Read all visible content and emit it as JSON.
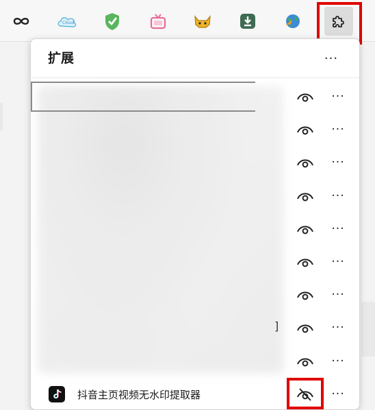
{
  "toolbar": {
    "buttons": [
      {
        "name": "reading-glasses-icon",
        "glyph": "∞"
      },
      {
        "name": "cloud-extension-icon",
        "glyph": "☁"
      },
      {
        "name": "adguard-shield-icon",
        "glyph": "✓"
      },
      {
        "name": "tv-extension-icon",
        "glyph": "📺"
      },
      {
        "name": "tampermonkey-icon",
        "glyph": "🐱"
      },
      {
        "name": "download-extension-icon",
        "glyph": "⬇"
      },
      {
        "name": "idm-globe-icon",
        "glyph": "🌐"
      },
      {
        "name": "extensions-puzzle-icon",
        "glyph": "puzzle"
      }
    ],
    "accent_colors": {
      "adguard": "#4caf50",
      "tv": "#e66c9a",
      "download": "#3f6b52",
      "highlight": "#e00000"
    }
  },
  "panel": {
    "title": "扩展",
    "header_more": "···",
    "rows": [
      {
        "name": "",
        "more": "···"
      },
      {
        "name": "",
        "more": "···"
      },
      {
        "name": "",
        "more": "···"
      },
      {
        "name": "",
        "more": "···"
      },
      {
        "name": "",
        "more": "···"
      },
      {
        "name": "",
        "more": "···"
      },
      {
        "name": "",
        "more": "···"
      },
      {
        "name": "",
        "more": "···",
        "trailing": "]"
      },
      {
        "name": "",
        "more": "···"
      },
      {
        "name": "抖音主页视频无水印提取器",
        "more": "···",
        "hidden": true
      }
    ]
  }
}
